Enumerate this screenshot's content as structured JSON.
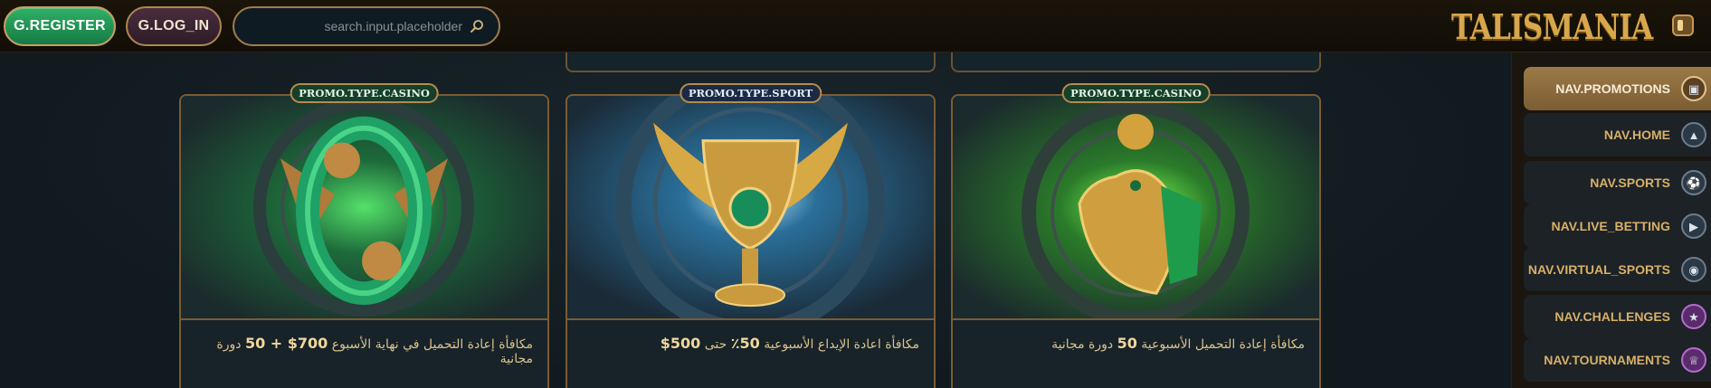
{
  "header": {
    "register_label": "G.REGISTER",
    "login_label": "G.LOG_IN",
    "search_placeholder": "search.input.placeholder",
    "brand": "TALISMANIA"
  },
  "cards": [
    {
      "badge": "PROMO.TYPE.CASINO",
      "title_prefix": "مكافأة إعادة التحميل في نهاية الأسبوع",
      "title_bold": "700$ + 50",
      "title_suffix": "دورة مجانية",
      "image": "green-serpent-emblem"
    },
    {
      "badge": "PROMO.TYPE.SPORT",
      "title_prefix": "مكافأة اعادة الإيداع الأسبوعية",
      "title_bold": "50٪",
      "title_suffix": "حتى",
      "title_bold2": "500$",
      "image": "golden-winged-cup"
    },
    {
      "badge": "PROMO.TYPE.CASINO",
      "title_prefix": "مكافأة إعادة التحميل الأسبوعية",
      "title_bold": "50",
      "title_suffix": "دورة مجانية",
      "image": "golden-horus-falcon"
    }
  ],
  "sidebar": {
    "items": [
      {
        "label": "NAV.PROMOTIONS",
        "icon": "gift-box-icon",
        "active": true
      },
      {
        "label": "NAV.HOME",
        "icon": "pyramid-icon",
        "active": false
      },
      {
        "label": "NAV.SPORTS",
        "icon": "soccer-ball-icon",
        "active": false
      },
      {
        "label": "NAV.LIVE_BETTING",
        "icon": "play-icon",
        "active": false
      },
      {
        "label": "NAV.VIRTUAL_SPORTS",
        "icon": "gamepad-icon",
        "active": false
      },
      {
        "label": "NAV.CHALLENGES",
        "icon": "medal-icon",
        "active": false
      },
      {
        "label": "NAV.TOURNAMENTS",
        "icon": "trophy-icon",
        "active": false
      }
    ]
  },
  "colors": {
    "accent_gold": "#c9a062",
    "register_green": "#2fb066",
    "background": "#121a1f"
  }
}
